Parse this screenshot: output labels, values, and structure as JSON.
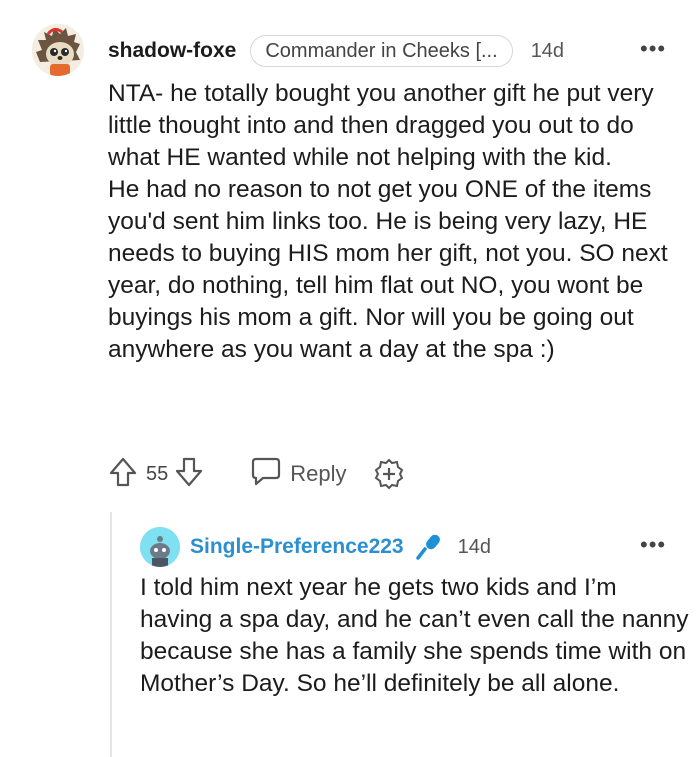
{
  "comment": {
    "username": "shadow-foxe",
    "flair": "Commander in Cheeks [...",
    "time": "14d",
    "more_icon": "more-horizontal-icon",
    "body": "NTA- he totally bought you another gift he put very little thought into and then dragged you out to do what HE wanted while not helping with the kid.\nHe had no reason to not get you ONE of the items you'd sent him links too. He is being very lazy, HE needs to buying HIS mom her gift, not you. SO next year, do nothing, tell him flat out NO, you wont be buyings his mom a gift. Nor will you be going out anywhere as you want a day at the spa :)",
    "votes": "55",
    "reply_label": "Reply",
    "upvote_icon": "arrow-up-icon",
    "downvote_icon": "arrow-down-icon",
    "reply_icon": "speech-bubble-icon",
    "award_icon": "award-plus-icon"
  },
  "reply": {
    "username": "Single-Preference223",
    "time": "14d",
    "mic_icon": "microphone-icon",
    "body": "I told him next year he gets two kids and I’m having a spa day, and he can’t even call the nanny because she has a family she spends time with on Mother’s Day. So he’ll definitely be all alone."
  },
  "colors": {
    "reply_username": "#2b8fd0",
    "reply_avatar_bg": "#7fe0f2",
    "mic": "#1e90d6"
  }
}
